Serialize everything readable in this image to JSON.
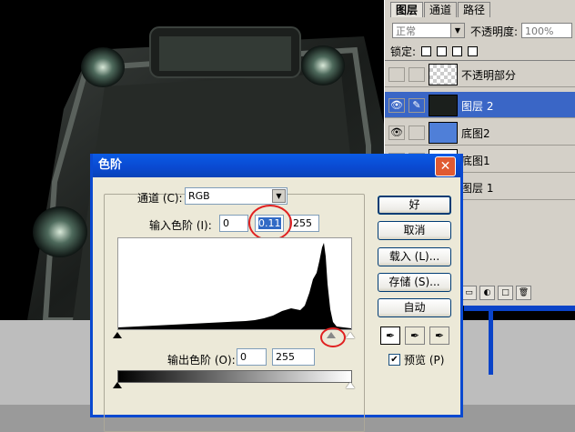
{
  "layers_panel": {
    "tabs": [
      "图层",
      "通道",
      "路径"
    ],
    "blend_mode": "正常",
    "opacity_label": "不透明度:",
    "opacity_value": "100%",
    "lock_label": "锁定:",
    "layers": [
      {
        "name": "不透明部分",
        "visible": false,
        "selected": false
      },
      {
        "name": "图层 2",
        "visible": true,
        "selected": true
      },
      {
        "name": "底图2",
        "visible": true,
        "selected": false
      },
      {
        "name": "底图1",
        "visible": false,
        "selected": false
      },
      {
        "name": "图层 1",
        "visible": false,
        "selected": false
      }
    ]
  },
  "levels_dialog": {
    "title": "色阶",
    "channel_label": "通道 (C):",
    "channel_value": "RGB",
    "input_levels_label": "输入色阶 (I):",
    "input_black": "0",
    "input_gamma": "0.11",
    "input_white": "255",
    "output_levels_label": "输出色阶 (O):",
    "output_black": "0",
    "output_white": "255",
    "buttons": {
      "ok": "好",
      "cancel": "取消",
      "load": "载入 (L)...",
      "save": "存储 (S)...",
      "auto": "自动"
    },
    "preview_label": "预览 (P)",
    "preview_checked": true
  },
  "colors": {
    "titlebar": "#0a49d0",
    "selection": "#316ac5",
    "annotation": "#e02020"
  }
}
